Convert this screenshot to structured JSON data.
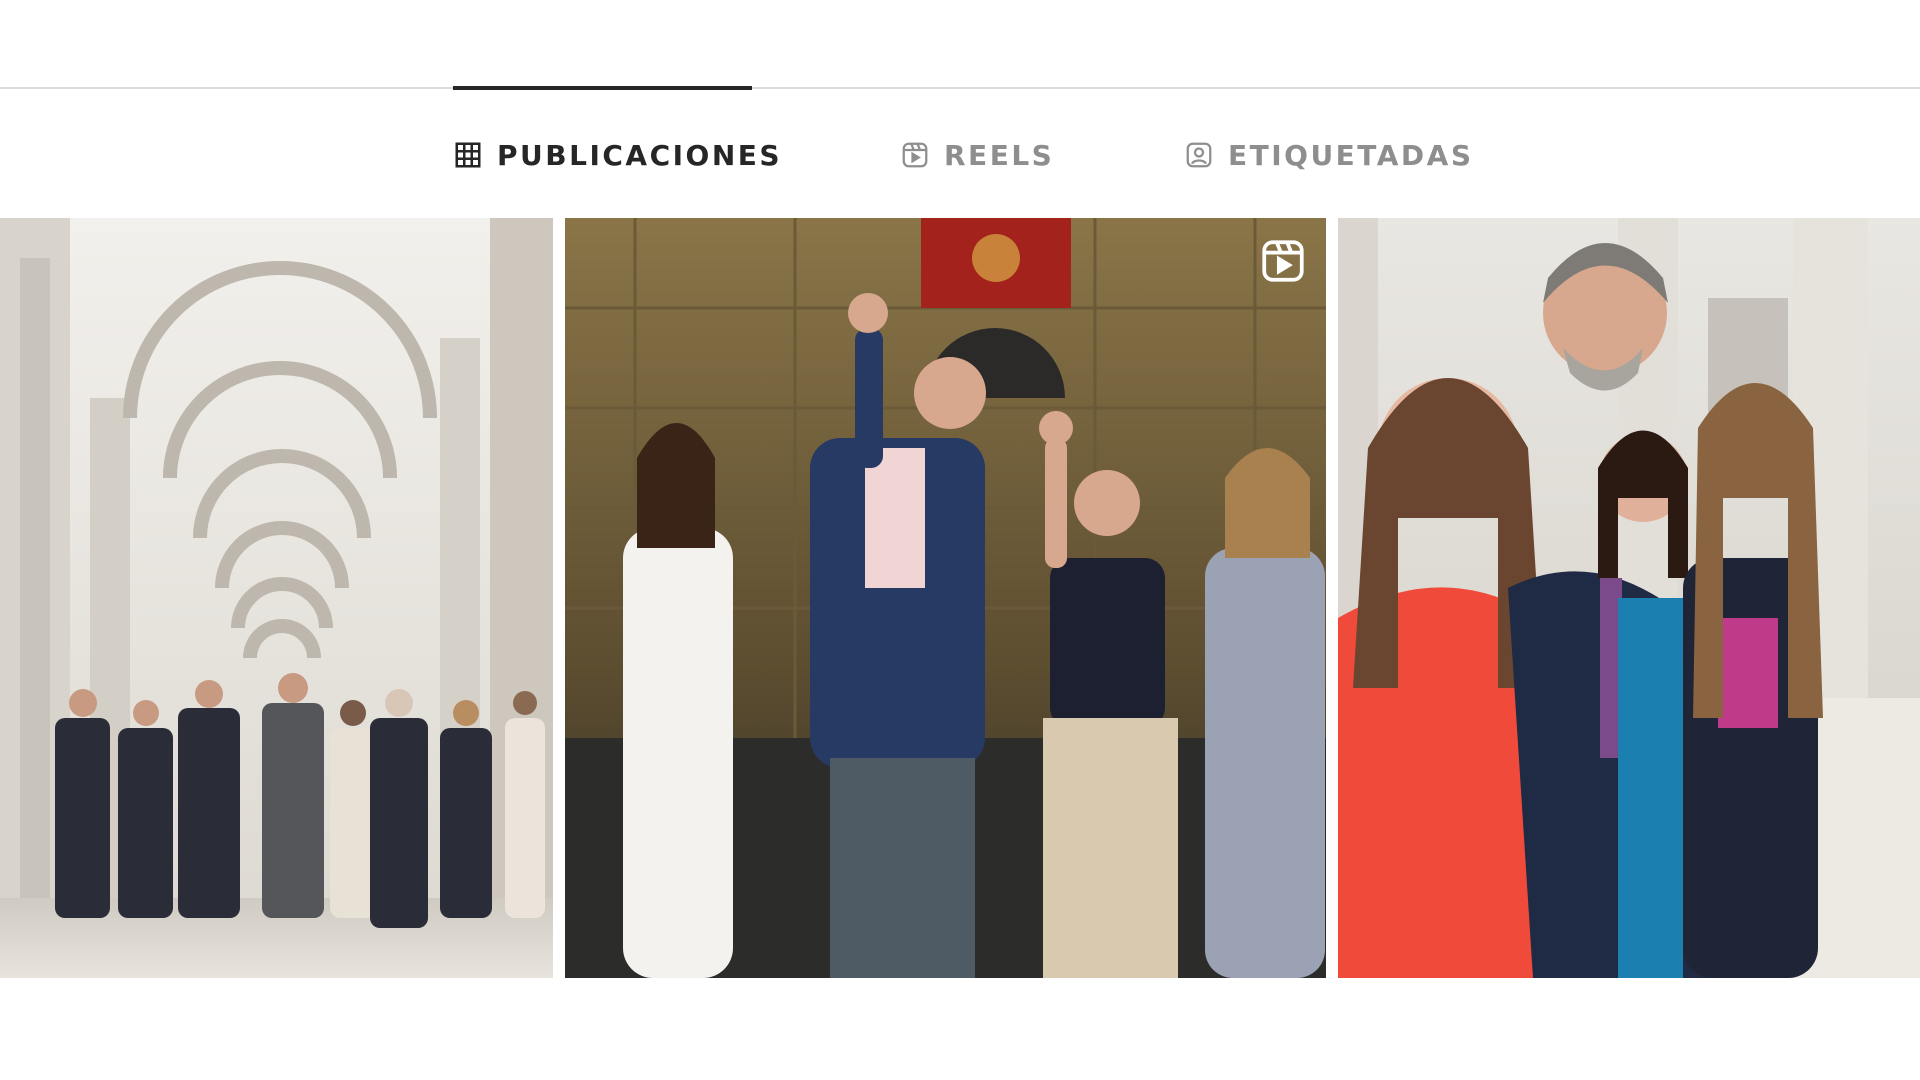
{
  "tabs": [
    {
      "label": "PUBLICACIONES",
      "icon": "grid-icon",
      "active": true
    },
    {
      "label": "REELS",
      "icon": "reels-icon",
      "active": false
    },
    {
      "label": "ETIQUETADAS",
      "icon": "tagged-icon",
      "active": false
    }
  ],
  "posts": [
    {
      "kind": "photo",
      "subject": "palace-gallery"
    },
    {
      "kind": "reel",
      "subject": "family-waving-night"
    },
    {
      "kind": "photo",
      "subject": "family-balcony"
    }
  ],
  "colors": {
    "active_tab": "#262626",
    "inactive_tab": "#8e8e8e",
    "divider": "#dbdbdb",
    "background": "#ffffff"
  }
}
